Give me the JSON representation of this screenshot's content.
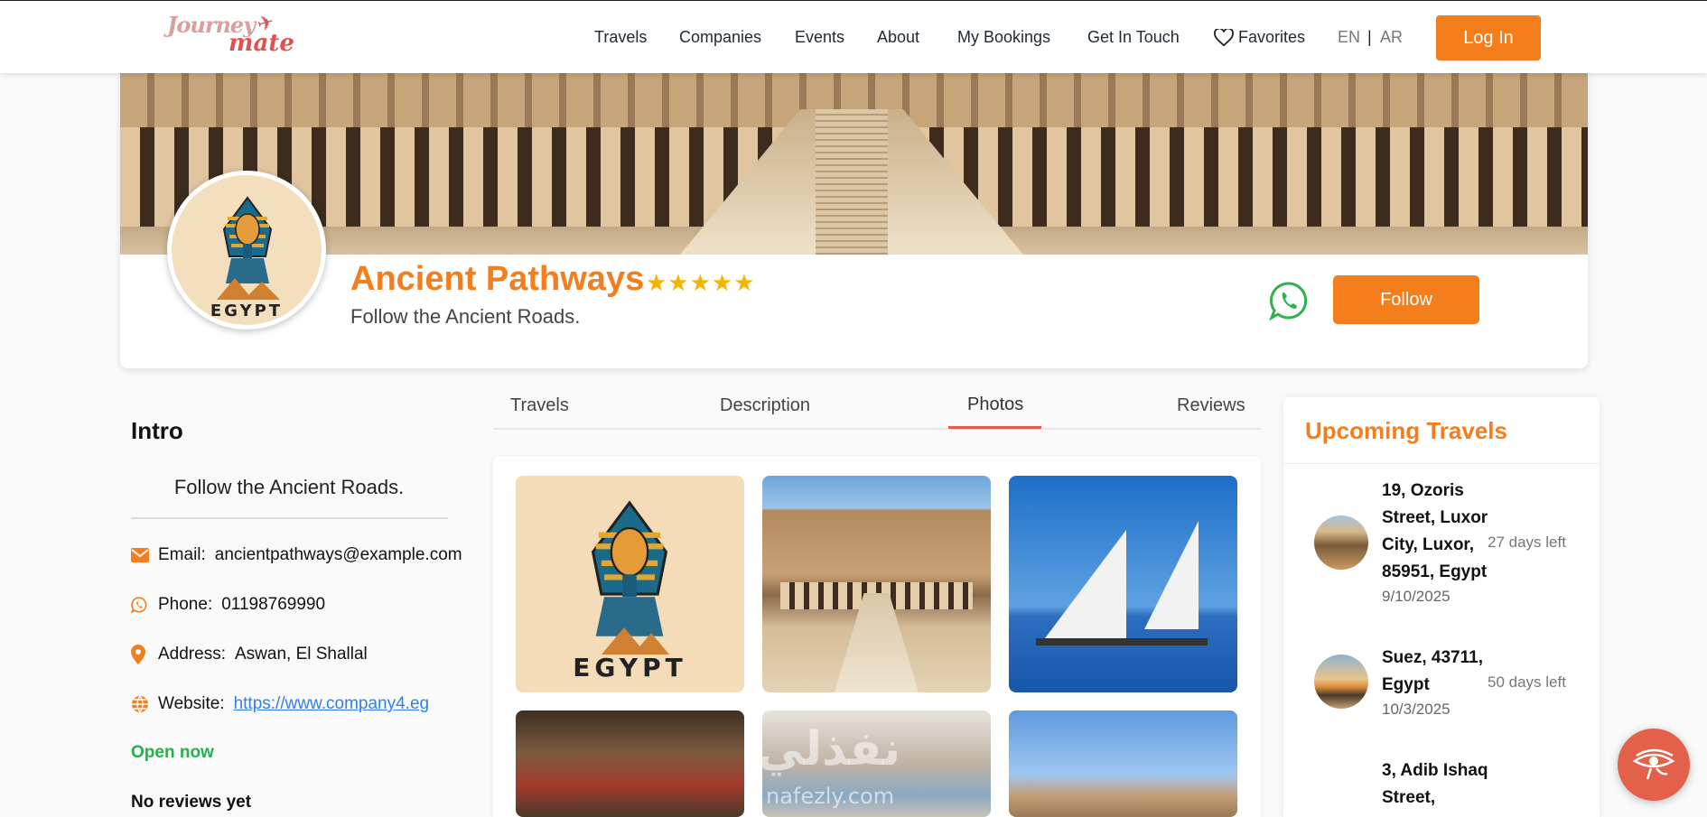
{
  "brand": {
    "logo_line1": "Journey",
    "logo_line2": "mate"
  },
  "nav": {
    "items": [
      "Travels",
      "Companies",
      "Events",
      "About",
      "My Bookings",
      "Get In Touch"
    ],
    "favorites": "Favorites",
    "lang_en": "EN",
    "lang_sep": "|",
    "lang_ar": "AR",
    "login": "Log In"
  },
  "profile": {
    "name": "Ancient Pathways",
    "rating_stars": "★★★★★",
    "rating": 5,
    "tagline": "Follow the Ancient Roads.",
    "avatar_text": "EGYPT",
    "follow": "Follow"
  },
  "intro": {
    "title": "Intro",
    "text": "Follow the Ancient Roads.",
    "email_label": "Email:",
    "email": "ancientpathways@example.com",
    "phone_label": "Phone:",
    "phone": "01198769990",
    "address_label": "Address:",
    "address": "Aswan, El Shallal",
    "website_label": "Website:",
    "website": "https://www.company4.eg",
    "status": "Open now",
    "reviews": "No reviews yet"
  },
  "tabs": {
    "items": [
      "Travels",
      "Description",
      "Photos",
      "Reviews"
    ],
    "active": "Photos"
  },
  "gallery": {
    "egypt_text": "EGYPT",
    "watermark": "نفذلي",
    "watermark_url": "nafezly.com"
  },
  "upcoming": {
    "title": "Upcoming Travels",
    "trips": [
      {
        "address": "19, Ozoris Street, Luxor City, Luxor, 85951, Egypt",
        "date": "9/10/2025",
        "days_left": "27 days left"
      },
      {
        "address": "Suez, 43711, Egypt",
        "date": "10/3/2025",
        "days_left": "50 days left"
      },
      {
        "address": "3, Adib Ishaq Street,",
        "date": "",
        "days_left": ""
      }
    ]
  },
  "colors": {
    "accent": "#f47d1c",
    "tab_underline": "#e85a4f",
    "open": "#22b14c",
    "link": "#2f80ed",
    "star": "#f5b400"
  }
}
